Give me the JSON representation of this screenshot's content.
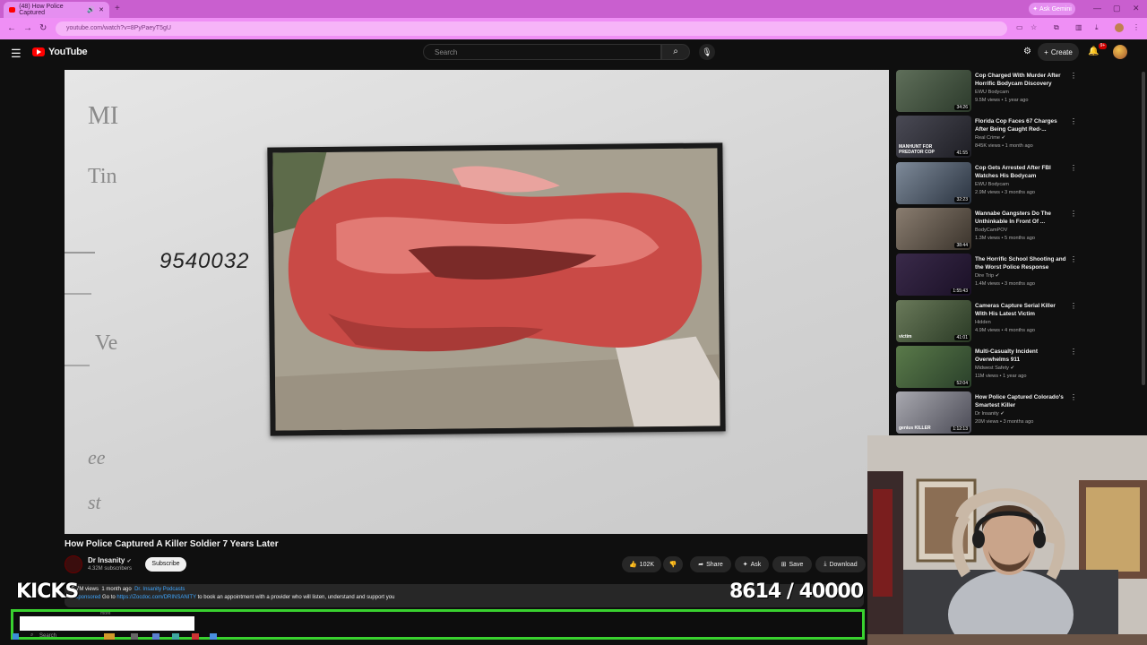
{
  "browser": {
    "tab_title": "(48) How Police Captured",
    "new_tab": "+",
    "ask_gemini": "Ask Gemini",
    "url": "youtube.com/watch?v=8PyPaeyT5gU"
  },
  "header": {
    "logo_text": "YouTube",
    "search_placeholder": "Search",
    "create_label": "Create",
    "notifications_badge": "9+"
  },
  "video": {
    "overlay_number": "9540032",
    "title": "How Police Captured A Killer Soldier 7 Years Later",
    "channel": {
      "name": "Dr Insanity",
      "subscribers": "4.32M subscribers"
    },
    "subscribe_label": "Subscribe",
    "actions": {
      "likes": "102K",
      "share": "Share",
      "ask": "Ask",
      "save": "Save",
      "download": "Download"
    },
    "description": {
      "views": "5.7M views",
      "age": "1 month ago",
      "tag": "Dr. Insanity Podcasts",
      "sponsored": "#Sponsored",
      "text_before_link": " Go to ",
      "link": "https://Zocdoc.com/DRINSANITY",
      "text_after_link": " to book an appointment with a provider who will listen, understand and support you"
    }
  },
  "stream_overlay": {
    "kicks_label": "KICKS",
    "goal_text": "8614  / 40000",
    "goal_current": 8614,
    "goal_target": 40000,
    "input_hint": "more",
    "taskbar_search": "Search"
  },
  "recommendations": [
    {
      "title": "Cop Charged With Murder After Horrific Bodycam Discovery",
      "channel": "EWU Bodycam",
      "meta": "9.5M views • 1 year ago",
      "duration": "34:26",
      "verified": false
    },
    {
      "title": "Florida Cop Faces 67 Charges After Being Caught Red-...",
      "channel": "Real Crime",
      "meta": "845K views • 1 month ago",
      "duration": "41:55",
      "verified": true,
      "thumb_text": "MANHUNT FOR PREDATOR COP"
    },
    {
      "title": "Cop Gets Arrested After FBI Watches His Bodycam",
      "channel": "EWU Bodycam",
      "meta": "2.9M views • 3 months ago",
      "duration": "32:23",
      "verified": false
    },
    {
      "title": "Wannabe Gangsters Do The Unthinkable In Front Of ...",
      "channel": "BodyCamPOV",
      "meta": "1.3M views • 5 months ago",
      "duration": "38:44",
      "verified": false
    },
    {
      "title": "The Horrific School Shooting and the Worst Police Response",
      "channel": "Dire Trip",
      "meta": "1.4M views • 3 months ago",
      "duration": "1:55:43",
      "verified": true
    },
    {
      "title": "Cameras Capture Serial Killer With His Latest Victim",
      "channel": "Hidden",
      "meta": "4.9M views • 4 months ago",
      "duration": "41:01",
      "verified": false,
      "thumb_text": "victim"
    },
    {
      "title": "Multi-Casualty Incident Overwhelms 911",
      "channel": "Midwest Safety",
      "meta": "11M views • 1 year ago",
      "duration": "52:04",
      "verified": true
    },
    {
      "title": "How Police Captured Colorado's Smartest Killer",
      "channel": "Dr Insanity",
      "meta": "20M views • 3 months ago",
      "duration": "1:12:13",
      "verified": true,
      "thumb_text": "genius KILLER"
    }
  ],
  "colors": {
    "browser_accent": "#c95fcf",
    "youtube_red": "#ff0000",
    "overlay_green": "#39d12f",
    "link_blue": "#3ea6ff"
  }
}
